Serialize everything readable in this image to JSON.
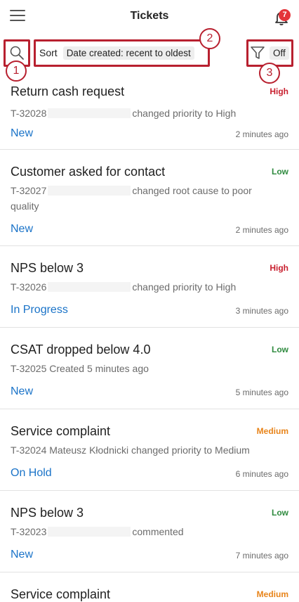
{
  "header": {
    "title": "Tickets",
    "notification_count": "7",
    "menu_icon": "hamburger-menu-icon",
    "bell_icon": "bell-icon"
  },
  "toolbar": {
    "search_icon": "search-icon",
    "sort_label": "Sort",
    "sort_value": "Date created: recent to oldest",
    "filter_icon": "filter-funnel-icon",
    "filter_value": "Off"
  },
  "callouts": [
    "1",
    "2",
    "3"
  ],
  "colors": {
    "accent": "#1a73c8",
    "high": "#c8202f",
    "medium": "#e8841a",
    "low": "#2e8a3e",
    "callout": "#b8202f"
  },
  "tickets": [
    {
      "title": "Return cash request",
      "priority": "High",
      "id": "T-32028",
      "action": "changed priority to High",
      "status": "New",
      "time": "2 minutes ago"
    },
    {
      "title": "Customer asked for contact",
      "priority": "Low",
      "id": "T-32027",
      "action": "changed root cause to poor quality",
      "status": "New",
      "time": "2 minutes ago"
    },
    {
      "title": "NPS below 3",
      "priority": "High",
      "id": "T-32026",
      "action": "changed priority to High",
      "status": "In Progress",
      "time": "3 minutes ago"
    },
    {
      "title": "CSAT dropped below 4.0",
      "priority": "Low",
      "id": "T-32025",
      "action": "Created 5 minutes ago",
      "status": "New",
      "time": "5 minutes ago"
    },
    {
      "title": "Service complaint",
      "priority": "Medium",
      "id": "T-32024",
      "action": "Mateusz Kłodnicki changed priority to Medium",
      "status": "On Hold",
      "time": "6 minutes ago"
    },
    {
      "title": "NPS below 3",
      "priority": "Low",
      "id": "T-32023",
      "action": "commented",
      "status": "New",
      "time": "7 minutes ago"
    },
    {
      "title": "Service complaint",
      "priority": "Medium"
    }
  ]
}
